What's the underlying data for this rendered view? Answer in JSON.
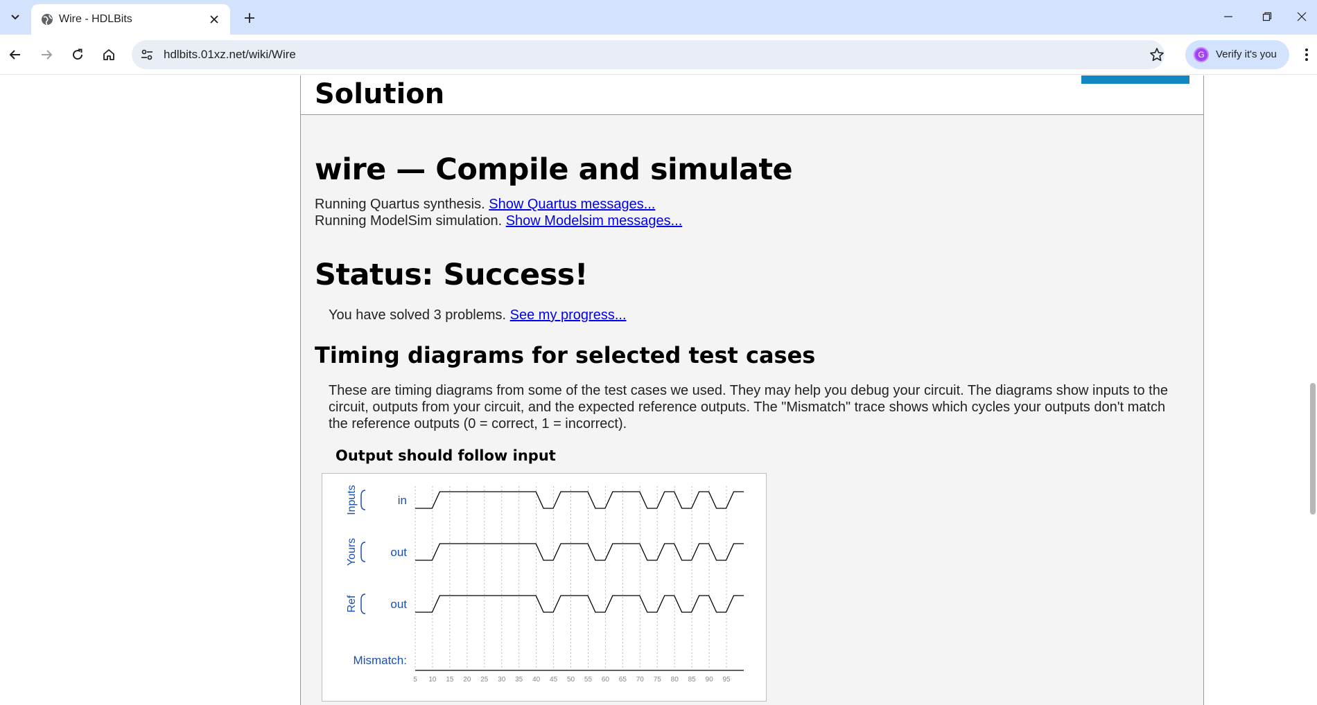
{
  "browser": {
    "tab_title": "Wire - HDLBits",
    "url": "hdlbits.01xz.net/wiki/Wire",
    "profile_label": "Verify it's you",
    "profile_initial": "G"
  },
  "page": {
    "prev_section_title": "Solution",
    "compile_heading": "wire — Compile and simulate",
    "quartus_text": "Running Quartus synthesis.",
    "quartus_link": "Show Quartus messages...",
    "modelsim_text": "Running ModelSim simulation.",
    "modelsim_link": "Show Modelsim messages...",
    "status_heading": "Status: Success!",
    "progress_text": "You have solved 3 problems.",
    "progress_link": "See my progress...",
    "timing_heading": "Timing diagrams for selected test cases",
    "timing_description": "These are timing diagrams from some of the test cases we used. They may help you debug your circuit. The diagrams show inputs to the circuit, outputs from your circuit, and the expected reference outputs. The \"Mismatch\" trace shows which cycles your outputs don't match the reference outputs (0 = correct, 1 = incorrect).",
    "diagram_title": "Output should follow input"
  },
  "timing_diagram": {
    "groups": [
      {
        "label": "Inputs",
        "signal": "in"
      },
      {
        "label": "Yours",
        "signal": "out"
      },
      {
        "label": "Ref",
        "signal": "out"
      }
    ],
    "mismatch_label": "Mismatch:",
    "time_ticks": [
      5,
      10,
      15,
      20,
      25,
      30,
      35,
      40,
      45,
      50,
      55,
      60,
      65,
      70,
      75,
      80,
      85,
      90,
      95
    ],
    "waveform_transitions": [
      {
        "t": 5,
        "v": 0
      },
      {
        "t": 11,
        "v": 1
      },
      {
        "t": 41,
        "v": 0
      },
      {
        "t": 46,
        "v": 1
      },
      {
        "t": 56,
        "v": 0
      },
      {
        "t": 61,
        "v": 1
      },
      {
        "t": 71,
        "v": 0
      },
      {
        "t": 76,
        "v": 1
      },
      {
        "t": 81,
        "v": 0
      },
      {
        "t": 86,
        "v": 1
      },
      {
        "t": 91,
        "v": 0
      },
      {
        "t": 96,
        "v": 1
      }
    ],
    "time_range": [
      5,
      100
    ],
    "mismatch_values": [
      0
    ],
    "colors": {
      "label": "#1a4fb4",
      "wave": "#000000",
      "grid": "#bbbbbb",
      "tick": "#888888"
    }
  }
}
